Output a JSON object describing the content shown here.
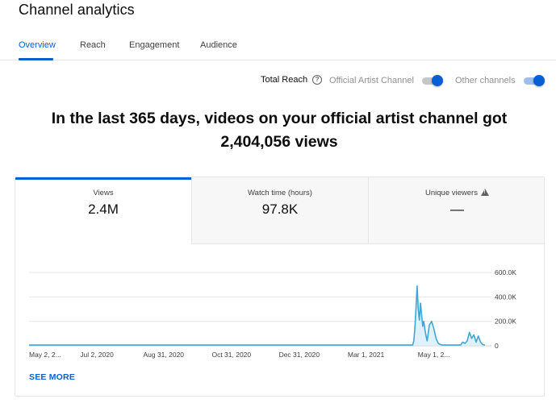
{
  "page": {
    "title": "Channel analytics"
  },
  "tabs": [
    {
      "label": "Overview",
      "active": true
    },
    {
      "label": "Reach",
      "active": false
    },
    {
      "label": "Engagement",
      "active": false
    },
    {
      "label": "Audience",
      "active": false
    }
  ],
  "toggles": {
    "total_reach": "Total Reach",
    "help_icon": "?",
    "official_artist_channel": {
      "label": "Official Artist Channel",
      "on": true,
      "enabled": false
    },
    "other_channels": {
      "label": "Other channels",
      "on": true,
      "enabled": true
    }
  },
  "headline": {
    "line1": "In the last 365 days, videos on your official artist channel got",
    "line2": "2,404,056 views"
  },
  "metrics": [
    {
      "label": "Views",
      "value": "2.4M",
      "selected": true
    },
    {
      "label": "Watch time (hours)",
      "value": "97.8K",
      "selected": false
    },
    {
      "label": "Unique viewers",
      "value": "—",
      "selected": false,
      "warning": true
    }
  ],
  "see_more": "SEE MORE",
  "colors": {
    "accent": "#065fd4",
    "line": "#3ea6d8",
    "fill": "#d7eef9"
  },
  "chart_data": {
    "type": "area",
    "y_tick_labels": [
      "600.0K",
      "400.0K",
      "200.0K",
      "0"
    ],
    "y_ticks": [
      600000,
      400000,
      200000,
      0
    ],
    "ylim": [
      0,
      640000
    ],
    "x_tick_labels": [
      "May 2, 2...",
      "Jul 2, 2020",
      "Aug 31, 2020",
      "Oct 31, 2020",
      "Dec 31, 2020",
      "Mar 1, 2021",
      "May 1, 2..."
    ],
    "x_tick_days": [
      0,
      61,
      121,
      182,
      243,
      303,
      364
    ],
    "grid": true,
    "series": [
      {
        "x": [
          0,
          320,
          345,
          346,
          347,
          348,
          349,
          350,
          351,
          352,
          353,
          354,
          355,
          356,
          357,
          358,
          360,
          362,
          364,
          366,
          368,
          370,
          372,
          374,
          376,
          378,
          380,
          382,
          384,
          386,
          388,
          390,
          392,
          394,
          396,
          398,
          400,
          402,
          404,
          406,
          408,
          410
        ],
        "values": [
          6000,
          6000,
          6000,
          40000,
          150000,
          320000,
          490000,
          300000,
          210000,
          350000,
          250000,
          160000,
          200000,
          130000,
          80000,
          40000,
          170000,
          200000,
          140000,
          60000,
          20000,
          10000,
          6000,
          6000,
          6000,
          6000,
          6000,
          6000,
          6000,
          6000,
          6000,
          30000,
          20000,
          40000,
          110000,
          60000,
          90000,
          30000,
          80000,
          30000,
          10000,
          6000
        ]
      }
    ]
  }
}
